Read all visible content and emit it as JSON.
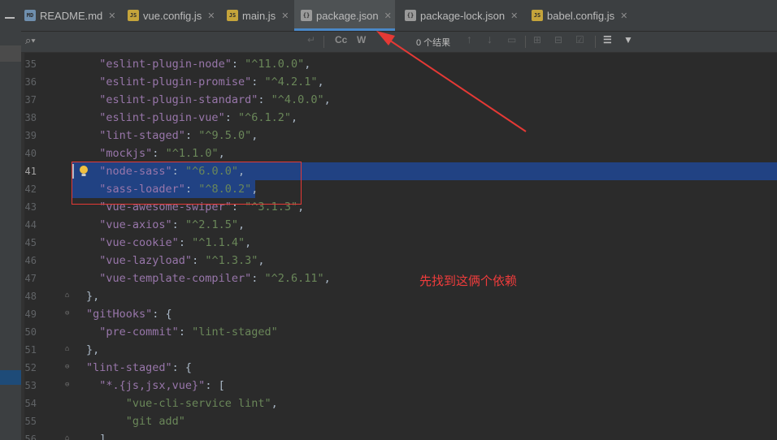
{
  "tabs": [
    {
      "label": "README.md",
      "icon": "md-file-icon",
      "active": false
    },
    {
      "label": "vue.config.js",
      "icon": "js-file-icon",
      "active": false
    },
    {
      "label": "main.js",
      "icon": "js-file-icon",
      "active": false
    },
    {
      "label": "package.json",
      "icon": "json-file-icon",
      "active": true
    },
    {
      "label": "package-lock.json",
      "icon": "json-file-icon",
      "active": false
    },
    {
      "label": "babel.config.js",
      "icon": "js-file-icon",
      "active": false
    }
  ],
  "search": {
    "match_case": "Cc",
    "words": "W",
    "result_count": "0 个结果"
  },
  "lines": [
    {
      "n": "35",
      "key": "\"eslint-plugin-node\"",
      "val": "\"^11.0.0\"",
      "indent": "  "
    },
    {
      "n": "36",
      "key": "\"eslint-plugin-promise\"",
      "val": "\"^4.2.1\"",
      "indent": "  "
    },
    {
      "n": "37",
      "key": "\"eslint-plugin-standard\"",
      "val": "\"^4.0.0\"",
      "indent": "  "
    },
    {
      "n": "38",
      "key": "\"eslint-plugin-vue\"",
      "val": "\"^6.1.2\"",
      "indent": "  "
    },
    {
      "n": "39",
      "key": "\"lint-staged\"",
      "val": "\"^9.5.0\"",
      "indent": "  "
    },
    {
      "n": "40",
      "key": "\"mockjs\"",
      "val": "\"^1.1.0\"",
      "indent": "  "
    },
    {
      "n": "41",
      "key": "\"node-sass\"",
      "val": "\"^6.0.0\"",
      "indent": "  "
    },
    {
      "n": "42",
      "key": "\"sass-loader\"",
      "val": "\"^8.0.2\"",
      "indent": "  "
    },
    {
      "n": "43",
      "key": "\"vue-awesome-swiper\"",
      "val": "\"^3.1.3\"",
      "indent": "  "
    },
    {
      "n": "44",
      "key": "\"vue-axios\"",
      "val": "\"^2.1.5\"",
      "indent": "  "
    },
    {
      "n": "45",
      "key": "\"vue-cookie\"",
      "val": "\"^1.1.4\"",
      "indent": "  "
    },
    {
      "n": "46",
      "key": "\"vue-lazyload\"",
      "val": "\"^1.3.3\"",
      "indent": "  "
    },
    {
      "n": "47",
      "key": "\"vue-template-compiler\"",
      "val": "\"^2.6.11\"",
      "indent": "  "
    },
    {
      "n": "48",
      "raw": "},"
    },
    {
      "n": "49",
      "key": "\"gitHooks\"",
      "open": "{",
      "indent": ""
    },
    {
      "n": "50",
      "key": "\"pre-commit\"",
      "val": "\"lint-staged\"",
      "indent": "  ",
      "last": true
    },
    {
      "n": "51",
      "raw": "},"
    },
    {
      "n": "52",
      "key": "\"lint-staged\"",
      "open": "{",
      "indent": ""
    },
    {
      "n": "53",
      "key": "\"*.{js,jsx,vue}\"",
      "open": "[",
      "indent": "  "
    },
    {
      "n": "54",
      "str": "\"vue-cli-service lint\"",
      "indent": "    ",
      "comma": true
    },
    {
      "n": "55",
      "str": "\"git add\"",
      "indent": "    "
    },
    {
      "n": "56",
      "raw": "  ]"
    }
  ],
  "annotation": "先找到这俩个依赖"
}
